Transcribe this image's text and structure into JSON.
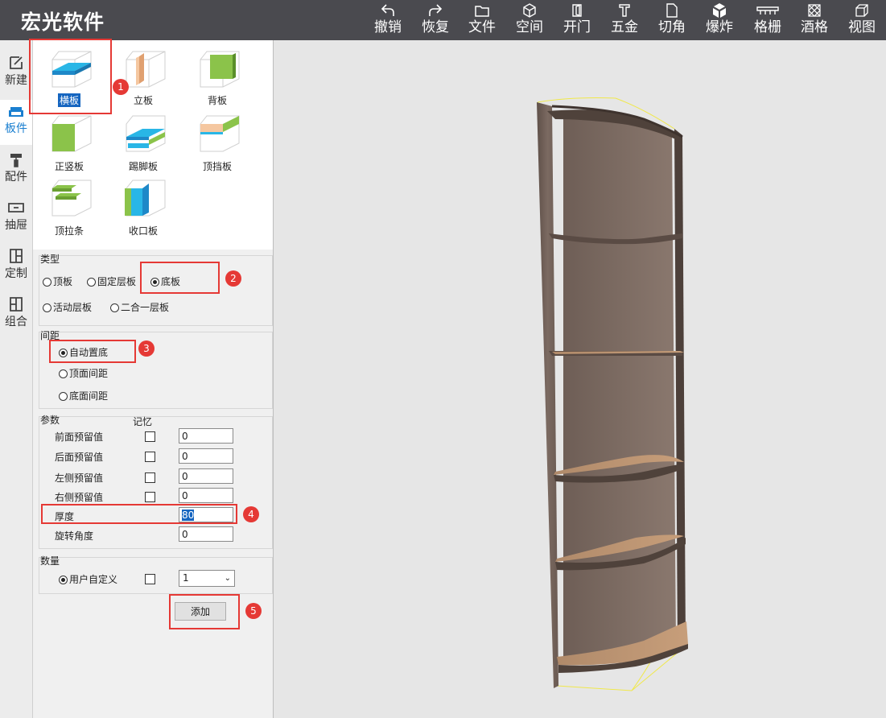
{
  "app": {
    "title": "宏光软件"
  },
  "toolbar": [
    {
      "label": "撤销",
      "icon": "undo-icon"
    },
    {
      "label": "恢复",
      "icon": "redo-icon"
    },
    {
      "label": "文件",
      "icon": "folder-icon"
    },
    {
      "label": "空间",
      "icon": "cube-icon"
    },
    {
      "label": "开门",
      "icon": "door-icon"
    },
    {
      "label": "五金",
      "icon": "hardware-icon"
    },
    {
      "label": "切角",
      "icon": "cut-corner-icon"
    },
    {
      "label": "爆炸",
      "icon": "explode-icon"
    },
    {
      "label": "格栅",
      "icon": "grille-icon"
    },
    {
      "label": "酒格",
      "icon": "wine-rack-icon"
    },
    {
      "label": "视图",
      "icon": "view-icon"
    }
  ],
  "sidebar": [
    {
      "label": "新建",
      "icon": "edit-icon",
      "active": false
    },
    {
      "label": "板件",
      "icon": "sofa-icon",
      "active": true
    },
    {
      "label": "配件",
      "icon": "roller-icon",
      "active": false
    },
    {
      "label": "抽屉",
      "icon": "drawer-icon",
      "active": false
    },
    {
      "label": "定制",
      "icon": "layout-icon",
      "active": false
    },
    {
      "label": "组合",
      "icon": "combine-icon",
      "active": false
    }
  ],
  "panel_types": [
    {
      "label": "横板",
      "selected": true
    },
    {
      "label": "立板",
      "selected": false
    },
    {
      "label": "背板",
      "selected": false
    },
    {
      "label": "正竖板",
      "selected": false
    },
    {
      "label": "踢脚板",
      "selected": false
    },
    {
      "label": "顶挡板",
      "selected": false
    },
    {
      "label": "顶拉条",
      "selected": false
    },
    {
      "label": "收口板",
      "selected": false
    }
  ],
  "type_group": {
    "title": "类型",
    "options": [
      {
        "label": "顶板",
        "checked": false
      },
      {
        "label": "固定层板",
        "checked": false
      },
      {
        "label": "底板",
        "checked": true
      },
      {
        "label": "活动层板",
        "checked": false
      },
      {
        "label": "二合一层板",
        "checked": false
      }
    ]
  },
  "spacing_group": {
    "title": "间距",
    "options": [
      {
        "label": "自动置底",
        "checked": true
      },
      {
        "label": "顶面间距",
        "checked": false
      },
      {
        "label": "底面间距",
        "checked": false
      }
    ]
  },
  "params_group": {
    "title": "参数",
    "memory_label": "记忆",
    "rows": [
      {
        "label": "前面预留值",
        "value": "0",
        "has_check": true
      },
      {
        "label": "后面预留值",
        "value": "0",
        "has_check": true
      },
      {
        "label": "左侧预留值",
        "value": "0",
        "has_check": true
      },
      {
        "label": "右侧预留值",
        "value": "0",
        "has_check": true
      },
      {
        "label": "厚度",
        "value": "80",
        "has_check": false,
        "highlighted": true
      },
      {
        "label": "旋转角度",
        "value": "0",
        "has_check": false
      }
    ]
  },
  "quantity_group": {
    "title": "数量",
    "option_label": "用户自定义",
    "value": "1"
  },
  "add_button": "添加",
  "annotations": [
    "1",
    "2",
    "3",
    "4",
    "5"
  ],
  "colors": {
    "header": "#4a4a4f",
    "accent": "#1a7fd0",
    "annotation": "#e53935",
    "selection": "#1565c0"
  }
}
